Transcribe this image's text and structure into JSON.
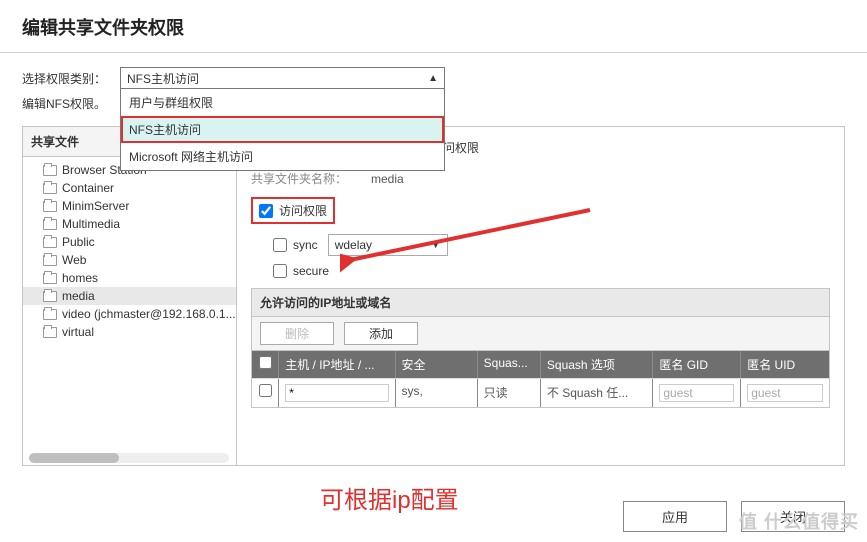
{
  "title": "编辑共享文件夹权限",
  "perm_type_label": "选择权限类别：",
  "edit_nfs_label": "编辑NFS权限。",
  "dropdown": {
    "selected": "NFS主机访问",
    "options": [
      "用户与群组权限",
      "NFS主机访问",
      "Microsoft 网络主机访问"
    ]
  },
  "left_header": "共享文件",
  "folders": [
    {
      "name": "Browser Station"
    },
    {
      "name": "Container"
    },
    {
      "name": "MinimServer"
    },
    {
      "name": "Multimedia"
    },
    {
      "name": "Public"
    },
    {
      "name": "Web"
    },
    {
      "name": "homes"
    },
    {
      "name": "media",
      "selected": true
    },
    {
      "name": "video (jchmaster@192.168.0.1..."
    },
    {
      "name": "virtual"
    }
  ],
  "right": {
    "desc": "您可以在此设置网络驱动器的NFS访问权限",
    "name_label": "共享文件夹名称：",
    "name_value": "media",
    "access_label": "访问权限",
    "sync_label": "sync",
    "wdelay": "wdelay",
    "secure_label": "secure",
    "ip_header": "允许访问的IP地址或域名",
    "btn_delete": "删除",
    "btn_add": "添加",
    "cols": {
      "host": "主机 / IP地址 / ...",
      "sec": "安全",
      "sq1": "Squas...",
      "sq2": "Squash 选项",
      "gid": "匿名 GID",
      "uid": "匿名 UID"
    },
    "row": {
      "host": "*",
      "sec": "sys,",
      "sq1": "只读",
      "sq2": "不 Squash 任...",
      "gid": "guest",
      "uid": "guest"
    }
  },
  "footer": {
    "apply": "应用",
    "close": "关闭"
  },
  "annotation": "可根据ip配置",
  "watermark": "值    什么值得买"
}
